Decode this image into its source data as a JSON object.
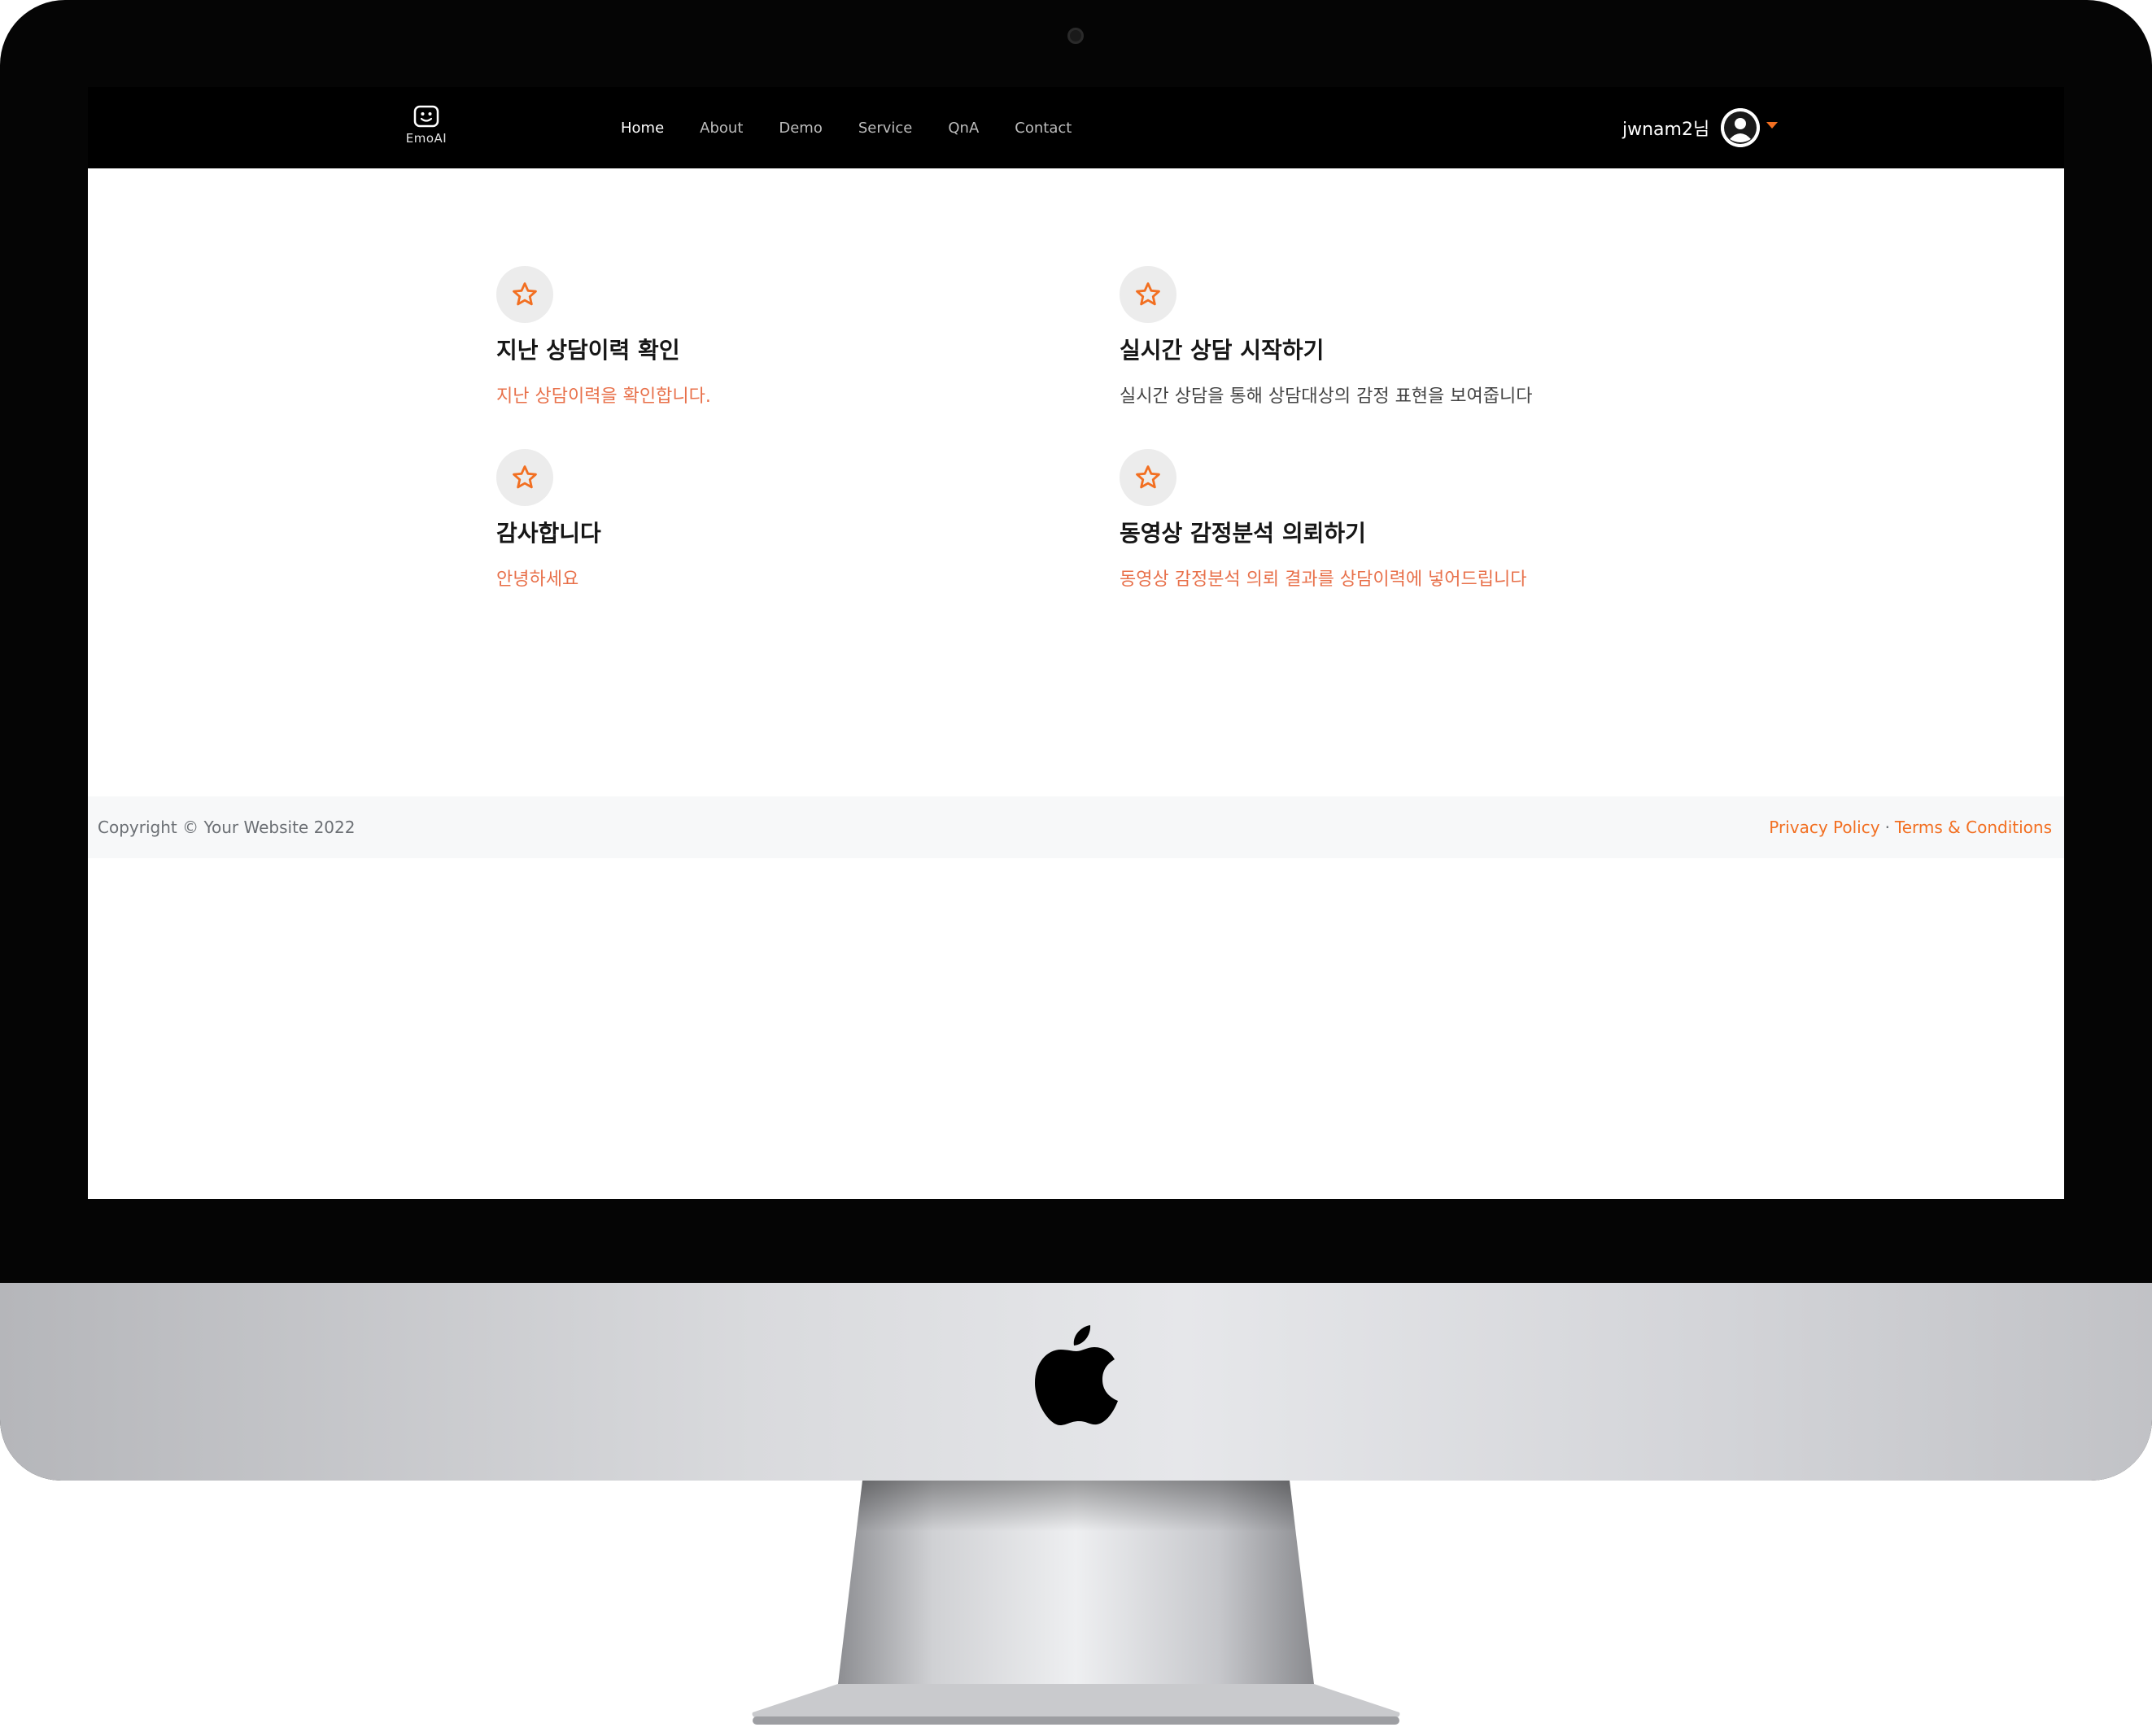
{
  "brand": {
    "name": "EmoAI",
    "icon": "robot-face-icon"
  },
  "nav": {
    "links": [
      {
        "label": "Home",
        "active": true
      },
      {
        "label": "About",
        "active": false
      },
      {
        "label": "Demo",
        "active": false
      },
      {
        "label": "Service",
        "active": false
      },
      {
        "label": "QnA",
        "active": false
      },
      {
        "label": "Contact",
        "active": false
      }
    ],
    "user_name": "jwnam2님",
    "avatar_icon": "user-circle-icon",
    "dropdown_icon": "caret-down-icon"
  },
  "features": [
    {
      "icon": "star-icon",
      "title": "지난 상담이력 확인",
      "desc": "지난 상담이력을 확인합니다."
    },
    {
      "icon": "star-icon",
      "title": "실시간 상담 시작하기",
      "desc": "실시간 상담을 통해 상담대상의 감정 표현을 보여줍니다"
    },
    {
      "icon": "star-icon",
      "title": "감사합니다",
      "desc": "안녕하세요"
    },
    {
      "icon": "star-icon",
      "title": "동영상 감정분석 의뢰하기",
      "desc": "동영상 감정분석 의뢰 결과를 상담이력에 넣어드립니다"
    }
  ],
  "footer": {
    "copyright": "Copyright © Your Website 2022",
    "privacy": "Privacy Policy",
    "separator": "·",
    "terms": "Terms & Conditions"
  },
  "colors": {
    "accent": "#f26f21",
    "navbar": "#000000",
    "footer_bg": "#f7f8f9"
  }
}
